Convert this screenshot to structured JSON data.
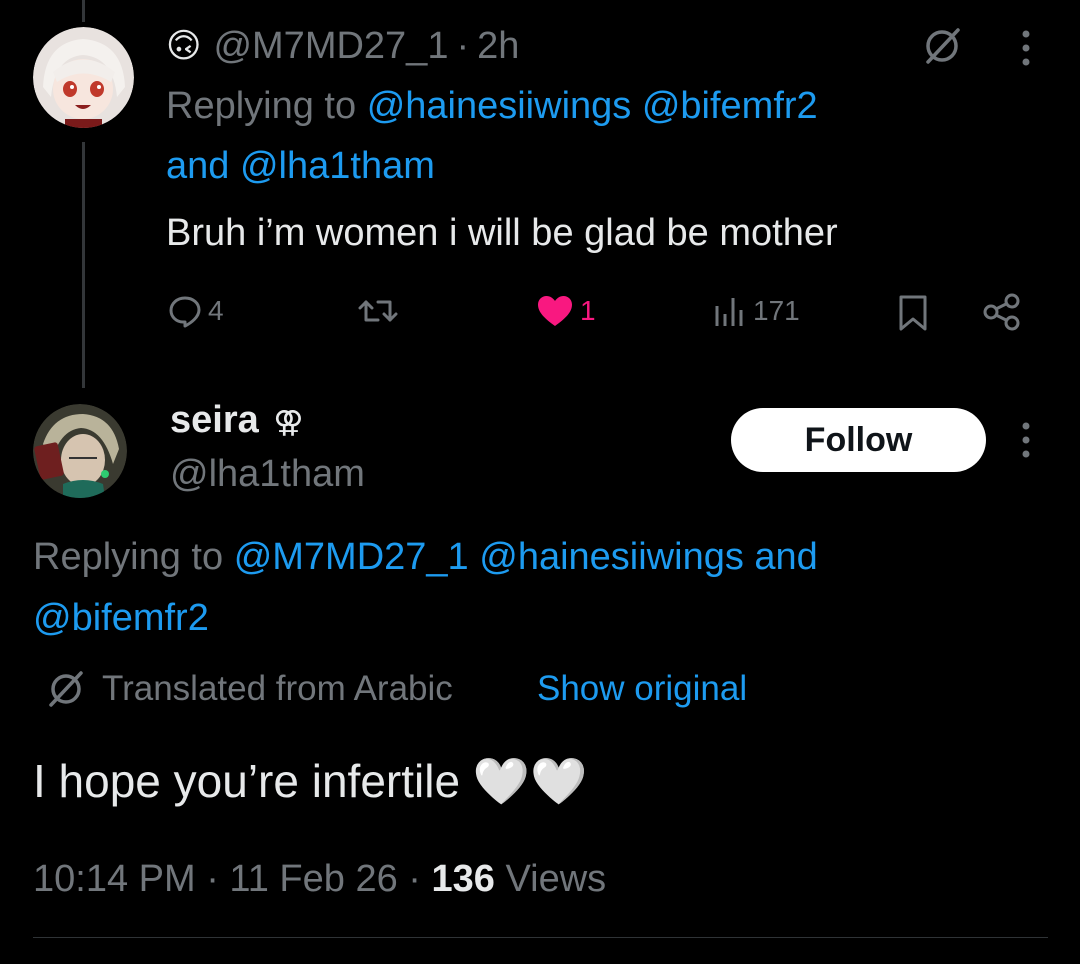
{
  "reply1": {
    "emoji": "🙃",
    "handle": "@M7MD27_1",
    "separator": "·",
    "time": "2h",
    "replying_prefix": "Replying to",
    "replying_handles_line1": "@hainesiiwings @bifemfr2",
    "replying_and": "and",
    "replying_handle_line2": "@lha1tham",
    "text": "Bruh i’m women i will be glad be mother",
    "stats": {
      "replies": "4",
      "likes": "1",
      "views": "171"
    },
    "like_color": "#f91880"
  },
  "main": {
    "display_name": "seira",
    "name_symbol": "⚢",
    "handle": "@lha1tham",
    "follow_label": "Follow",
    "replying_prefix": "Replying to",
    "replying_line1": "@M7MD27_1 @hainesiiwings and",
    "replying_line2": "@bifemfr2",
    "translated_label": "Translated from Arabic",
    "show_original": "Show original",
    "text": "I hope you’re infertile 🤍🤍",
    "timestamp": "10:14 PM · 11 Feb 26 ·",
    "views_count": "136",
    "views_label": "Views"
  },
  "colors": {
    "accent": "#1d9bf0",
    "secondary_text": "#71767b",
    "primary_text": "#e7e9ea"
  },
  "icons": [
    "grok-slash-icon",
    "more-icon",
    "reply-icon",
    "retweet-icon",
    "like-icon",
    "views-icon",
    "bookmark-icon",
    "share-icon",
    "translate-icon"
  ]
}
